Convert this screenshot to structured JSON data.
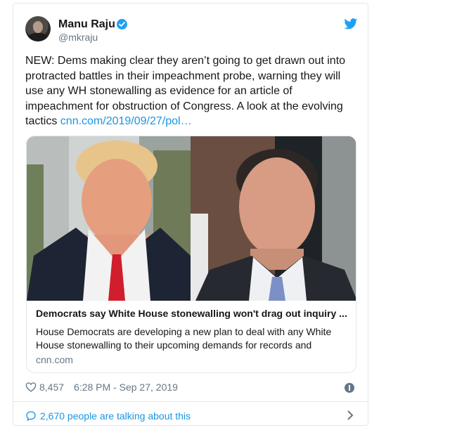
{
  "tweet": {
    "author_name": "Manu Raju",
    "author_handle": "@mkraju",
    "text": "NEW: Dems making clear they aren’t going to get drawn out into protracted battles in their impeachment probe, warning they will use any WH stonewalling as evidence for an article of impeachment for obstruction of Congress. A look at the evolving tactics",
    "link_text": "cnn.com/2019/09/27/pol…",
    "likes": "8,457",
    "timestamp": "6:28 PM - Sep 27, 2019",
    "conversation": "2,670 people are talking about this"
  },
  "card": {
    "title": "Democrats say White House stonewalling won't drag out inquiry ...",
    "description": "House Democrats are developing a new plan to deal with any White House stonewalling to their upcoming demands for records and",
    "domain": "cnn.com"
  },
  "colors": {
    "link_blue": "#1b95e0",
    "twitter_blue": "#1da1f2",
    "muted_gray": "#657786",
    "border": "#e1e8ed"
  },
  "icons": [
    "verified-icon",
    "twitter-bird-icon",
    "heart-icon",
    "info-icon",
    "comment-bubble-icon",
    "chevron-right-icon"
  ]
}
